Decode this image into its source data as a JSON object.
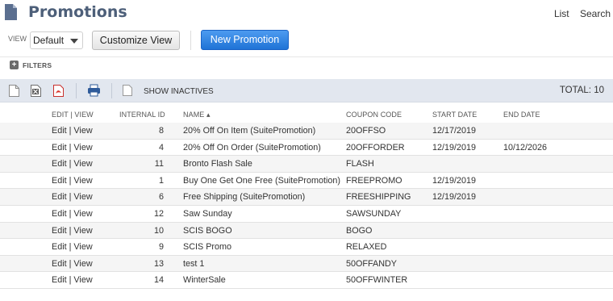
{
  "header": {
    "title": "Promotions",
    "links": [
      "List",
      "Search"
    ]
  },
  "view": {
    "label": "VIEW",
    "selected": "Default",
    "customize_label": "Customize View",
    "new_label": "New Promotion"
  },
  "filters": {
    "label": "FILTERS"
  },
  "toolbar": {
    "show_inactives": "SHOW INACTIVES",
    "total": "TOTAL: 10"
  },
  "table": {
    "headers": {
      "edit_view": "EDIT | VIEW",
      "internal_id": "INTERNAL ID",
      "name": "NAME ▴",
      "coupon_code": "COUPON CODE",
      "start_date": "START DATE",
      "end_date": "END DATE"
    },
    "edit_label": "Edit",
    "divider": "|",
    "view_label": "View",
    "rows": [
      {
        "id": "8",
        "name": "20% Off On Item (SuitePromotion)",
        "code": "20OFFSO",
        "start": "12/17/2019",
        "end": ""
      },
      {
        "id": "4",
        "name": "20% Off On Order (SuitePromotion)",
        "code": "20OFFORDER",
        "start": "12/19/2019",
        "end": "10/12/2026"
      },
      {
        "id": "11",
        "name": "Bronto Flash Sale",
        "code": "FLASH",
        "start": "",
        "end": ""
      },
      {
        "id": "1",
        "name": "Buy One Get One Free (SuitePromotion)",
        "code": "FREEPROMO",
        "start": "12/19/2019",
        "end": ""
      },
      {
        "id": "6",
        "name": "Free Shipping (SuitePromotion)",
        "code": "FREESHIPPING",
        "start": "12/19/2019",
        "end": ""
      },
      {
        "id": "12",
        "name": "Saw Sunday",
        "code": "SAWSUNDAY",
        "start": "",
        "end": ""
      },
      {
        "id": "10",
        "name": "SCIS BOGO",
        "code": "BOGO",
        "start": "",
        "end": ""
      },
      {
        "id": "9",
        "name": "SCIS Promo",
        "code": "RELAXED",
        "start": "",
        "end": ""
      },
      {
        "id": "13",
        "name": "test 1",
        "code": "50OFFANDY",
        "start": "",
        "end": ""
      },
      {
        "id": "14",
        "name": "WinterSale",
        "code": "50OFFWINTER",
        "start": "",
        "end": ""
      }
    ]
  },
  "colors": {
    "title": "#4d5f79",
    "primary_button": "#1f73d6",
    "toolbar_bg": "#e2e7ef"
  },
  "icons": [
    "page-icon",
    "filter-plus-icon",
    "new-document-icon",
    "excel-export-icon",
    "pdf-export-icon",
    "print-icon",
    "show-inactives-checkbox-icon",
    "select-caret-icon"
  ]
}
